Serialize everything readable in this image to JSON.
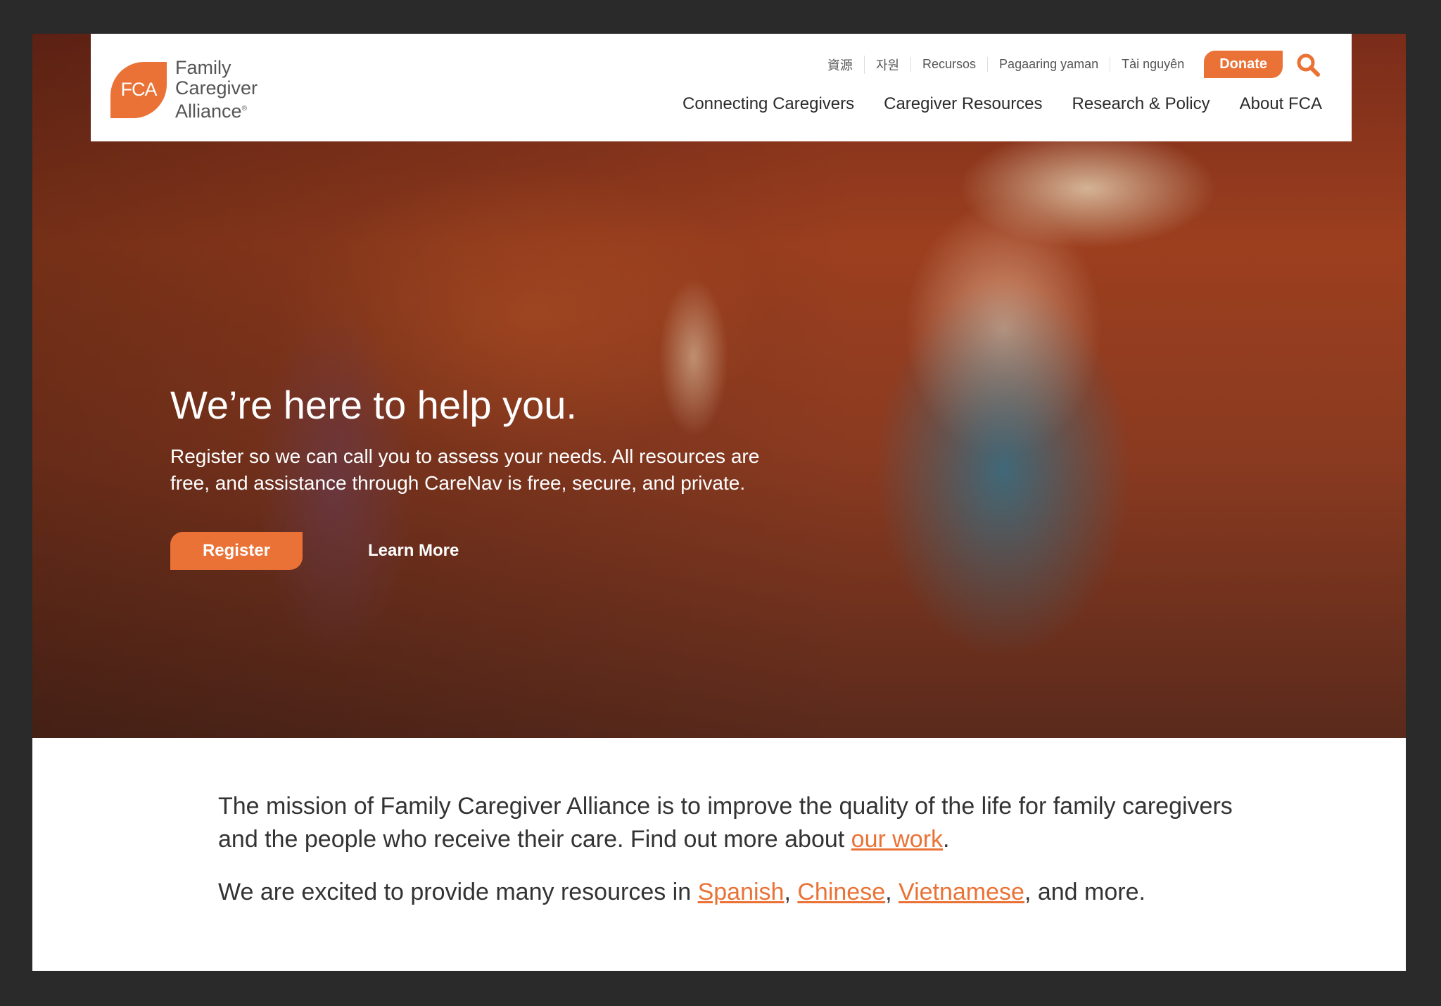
{
  "brand": {
    "logo_mark": "FCA",
    "name_lines": [
      "Family",
      "Caregiver",
      "Alliance"
    ],
    "registered": "®",
    "accent_color": "#ea7236"
  },
  "utility_nav": {
    "languages": [
      "資源",
      "자원",
      "Recursos",
      "Pagaaring yaman",
      "Tài nguyên"
    ],
    "donate_label": "Donate",
    "search_icon": "search-icon"
  },
  "main_nav": {
    "items": [
      "Connecting Caregivers",
      "Caregiver Resources",
      "Research & Policy",
      "About FCA"
    ]
  },
  "hero": {
    "title": "We’re here to help you.",
    "text": "Register so we can call you to assess your needs. All resources are free, and assistance through CareNav is free, secure, and private.",
    "register_label": "Register",
    "learn_more_label": "Learn More"
  },
  "mission": {
    "p1_text": "The mission of Family Caregiver Alliance is to improve the quality of the life for family caregivers and the people who receive their care. Find out more about ",
    "p1_link": "our work",
    "p1_end": ".",
    "p2_text": "We are excited to provide many resources in ",
    "links": [
      "Spanish",
      "Chinese",
      "Vietnamese"
    ],
    "sep": ", ",
    "p2_end": ", and more."
  }
}
